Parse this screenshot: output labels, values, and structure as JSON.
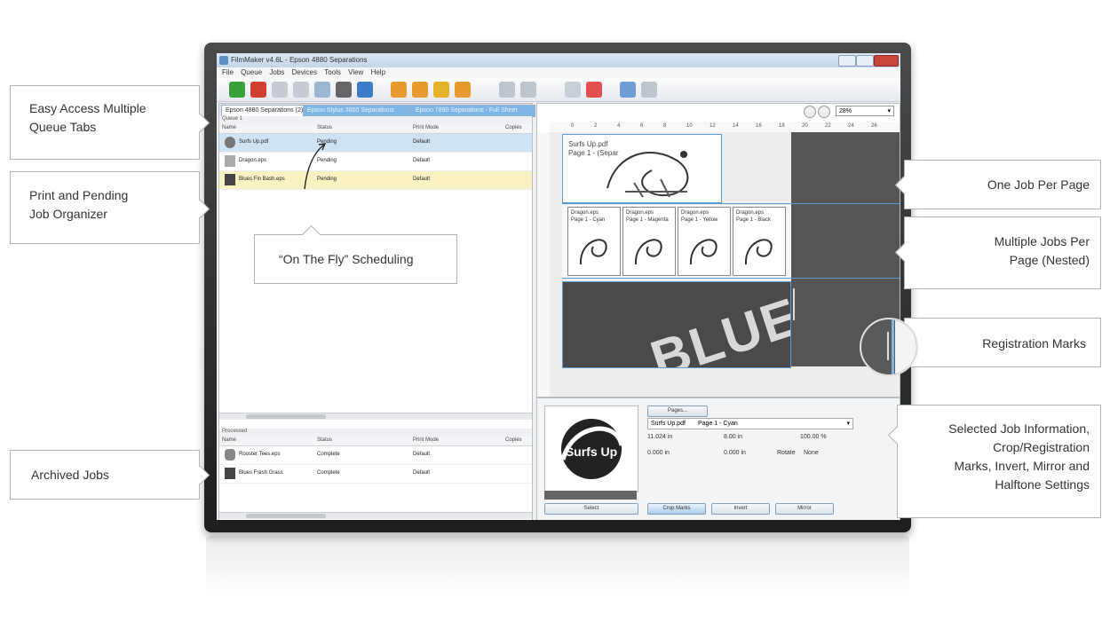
{
  "window": {
    "title": "FilmMaker v4.6L - Epson 4880 Separations",
    "menu": [
      "File",
      "Queue",
      "Jobs",
      "Devices",
      "Tools",
      "View",
      "Help"
    ]
  },
  "queue_tabs": [
    "Epson 4880 Separations (2)",
    "Epson Stylus 3800 Separations",
    "Epson 7890 Separations - Full Sheet"
  ],
  "queue": {
    "label": "Queue 1",
    "columns": [
      "Name",
      "Status",
      "Print Mode",
      "Copies"
    ],
    "rows": [
      {
        "name": "Surfs Up.pdf",
        "status": "Pending",
        "mode": "Default"
      },
      {
        "name": "Dragon.eps",
        "status": "Pending",
        "mode": "Default"
      },
      {
        "name": "Blues Fin Bash.eps",
        "status": "Pending",
        "mode": "Default"
      }
    ]
  },
  "archived": {
    "label": "Processed",
    "columns": [
      "Name",
      "Status",
      "Print Mode",
      "Copies"
    ],
    "rows": [
      {
        "name": "Rooster Tees.eps",
        "status": "Complete",
        "mode": "Default"
      },
      {
        "name": "Blues Fresh Grass",
        "status": "Complete",
        "mode": "Default"
      }
    ]
  },
  "preview": {
    "zoom": "28%",
    "ruler_ticks": [
      "0",
      "2",
      "4",
      "6",
      "8",
      "10",
      "12",
      "14",
      "16",
      "18",
      "20",
      "22",
      "24",
      "26"
    ],
    "job1": {
      "line1": "Surfs Up.pdf",
      "line2": "Page 1 - (Separ"
    },
    "nested_jobs": [
      {
        "line1": "Dragon.eps",
        "line2": "Page 1 - Cyan"
      },
      {
        "line1": "Dragon.eps",
        "line2": "Page 1 - Magenta"
      },
      {
        "line1": "Dragon.eps",
        "line2": "Page 1 - Yellow"
      },
      {
        "line1": "Dragon.eps",
        "line2": "Page 1 - Black"
      }
    ],
    "banner_text": "BLUES"
  },
  "info": {
    "pages_button": "Pages...",
    "job_name": "Surfs Up.pdf",
    "page_select": "Page 1 - Cyan",
    "width": "11.024 in",
    "height": "8.00 in",
    "scale": "100.00 %",
    "offset_x": "0.000 in",
    "offset_y": "0.000 in",
    "rotate_label": "Rotate",
    "rotate_value": "None",
    "thumb_art": "Surfs Up",
    "select_button": "Select",
    "crop_button": "Crop Marks",
    "invert_button": "Invert",
    "mirror_button": "Mirror"
  },
  "callouts": {
    "queue_tabs": [
      "Easy Access Multiple",
      "Queue Tabs"
    ],
    "organizer": [
      "Print and Pending",
      "Job Organizer"
    ],
    "scheduling": "“On The Fly” Scheduling",
    "archived": "Archived Jobs",
    "one_job": "One Job Per Page",
    "multi_jobs": [
      "Multiple Jobs Per",
      "Page (Nested)"
    ],
    "registration": "Registration Marks",
    "selected_info": [
      "Selected Job Information,",
      "Crop/Registration",
      "Marks, Invert, Mirror and",
      "Halftone Settings"
    ]
  },
  "colors": {
    "tab_active": "#ffffff",
    "tab_inactive": "#7fb6e6",
    "selected_row": "#cfe3f5",
    "highlight_row": "#fbf2c4",
    "accent": "#3d8fd6"
  }
}
